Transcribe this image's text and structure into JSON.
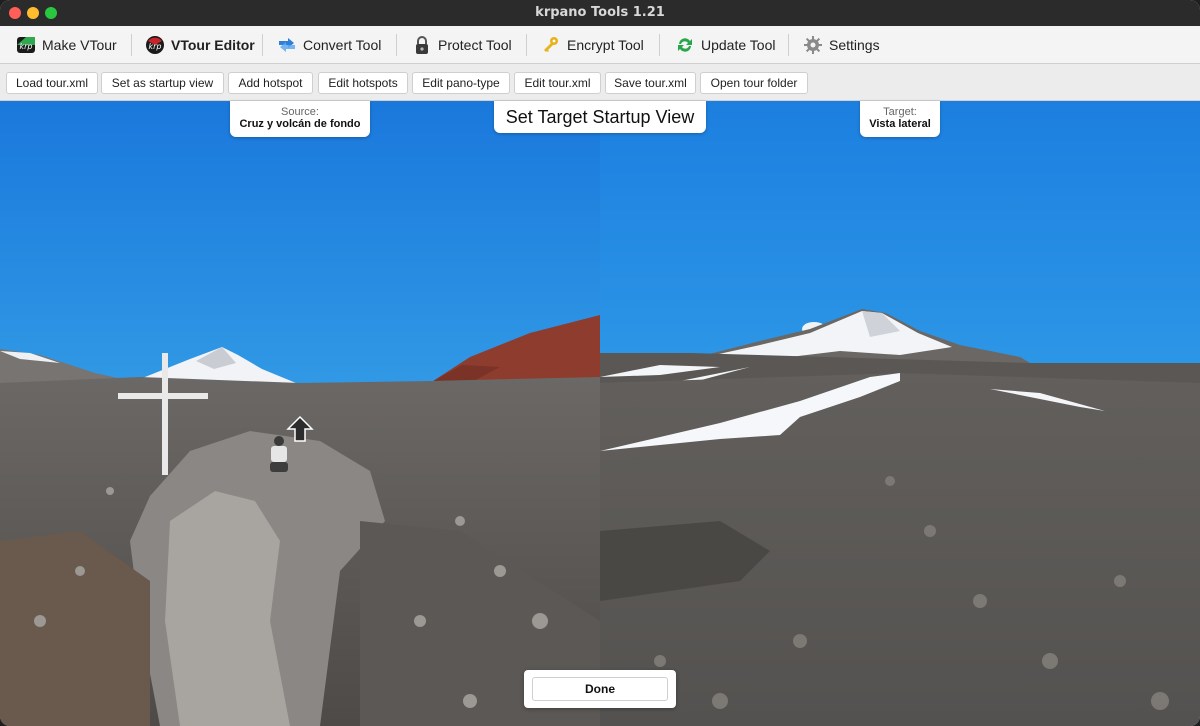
{
  "window": {
    "title": "krpano Tools 1.21"
  },
  "main_toolbar": [
    {
      "label": "Make VTour",
      "icon": "krpano-logo-green-icon"
    },
    {
      "label": "VTour Editor",
      "icon": "krpano-logo-red-icon",
      "active": true
    },
    {
      "label": "Convert Tool",
      "icon": "convert-arrows-icon"
    },
    {
      "label": "Protect Tool",
      "icon": "padlock-icon"
    },
    {
      "label": "Encrypt Tool",
      "icon": "key-icon"
    },
    {
      "label": "Update Tool",
      "icon": "refresh-arrows-icon"
    },
    {
      "label": "Settings",
      "icon": "gear-icon"
    }
  ],
  "sub_toolbar": [
    "Load tour.xml",
    "Set as startup view",
    "Add hotspot",
    "Edit hotspots",
    "Edit pano-type",
    "Edit tour.xml",
    "Save tour.xml",
    "Open tour folder"
  ],
  "overlay": {
    "heading": "Set Target Startup View",
    "source_label": "Source:",
    "source_name": "Cruz y volcán de fondo",
    "target_label": "Target:",
    "target_name": "Vista lateral",
    "done_label": "Done"
  },
  "colors": {
    "sky_top": "#1e7fe0",
    "sky_bottom": "#48b8ee",
    "ground": "#5c5a58",
    "snow": "#f4f6f8",
    "red_ridge": "#8c3a2c"
  }
}
